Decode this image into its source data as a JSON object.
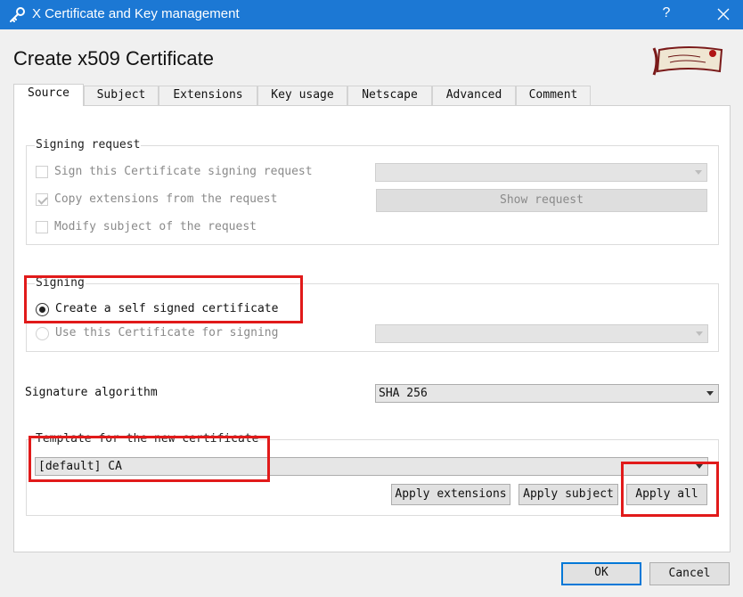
{
  "window": {
    "title": "X Certificate and Key management",
    "help_label": "?"
  },
  "dialog": {
    "heading": "Create x509 Certificate"
  },
  "tabs": [
    {
      "label": "Source",
      "active": true
    },
    {
      "label": "Subject"
    },
    {
      "label": "Extensions"
    },
    {
      "label": "Key usage"
    },
    {
      "label": "Netscape"
    },
    {
      "label": "Advanced"
    },
    {
      "label": "Comment"
    }
  ],
  "signing_request": {
    "title": "Signing request",
    "sign_csr_label": "Sign this Certificate signing request",
    "sign_csr_checked": false,
    "sign_csr_value": "",
    "copy_extensions_label": "Copy extensions from the request",
    "copy_extensions_checked": true,
    "show_request_label": "Show request",
    "modify_subject_label": "Modify subject of the request",
    "modify_subject_checked": false
  },
  "signing": {
    "title": "Signing",
    "self_signed_label": "Create a self signed certificate",
    "self_signed_selected": true,
    "use_cert_label": "Use this Certificate for signing",
    "use_cert_selected": false,
    "use_cert_value": ""
  },
  "signature_algorithm": {
    "label": "Signature algorithm",
    "value": "SHA 256"
  },
  "template": {
    "title": "Template for the new certificate",
    "value": "[default] CA",
    "apply_extensions_label": "Apply extensions",
    "apply_subject_label": "Apply subject",
    "apply_all_label": "Apply all"
  },
  "footer": {
    "ok_label": "OK",
    "cancel_label": "Cancel"
  },
  "colors": {
    "titlebar": "#1c78d4",
    "highlight": "#e11a1a",
    "default_button_border": "#0078d7"
  }
}
